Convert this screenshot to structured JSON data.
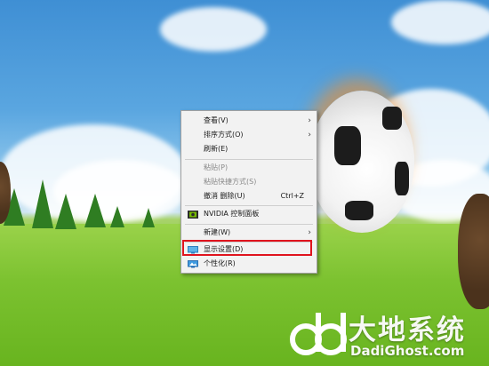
{
  "context_menu": {
    "items": [
      {
        "label": "查看(V)",
        "submenu_arrow": "›"
      },
      {
        "label": "排序方式(O)",
        "submenu_arrow": "›"
      },
      {
        "label": "刷新(E)"
      },
      {
        "label": "粘贴(P)"
      },
      {
        "label": "粘贴快捷方式(S)"
      },
      {
        "label": "撤消 删除(U)",
        "shortcut": "Ctrl+Z"
      },
      {
        "label": "NVIDIA 控制面板",
        "icon": "nvidia-icon"
      },
      {
        "label": "新建(W)",
        "submenu_arrow": "›"
      },
      {
        "label": "显示设置(D)",
        "icon": "display-settings-icon"
      },
      {
        "label": "个性化(R)",
        "icon": "personalize-icon"
      }
    ],
    "highlight_color": "#e0141e"
  },
  "watermark": {
    "title": "大地系统",
    "url": "DadiGhost.com"
  }
}
